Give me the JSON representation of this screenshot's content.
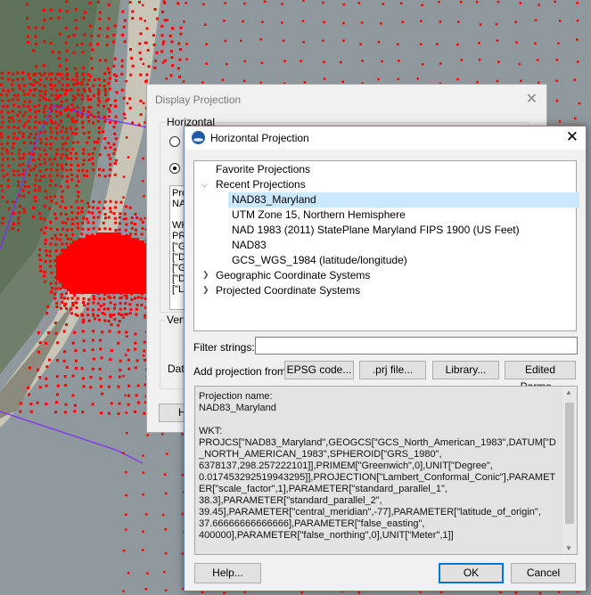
{
  "background_window": {
    "title": "Display Projection",
    "close": "✕",
    "group_horizontal": "Horizontal",
    "group_vertical_partial": "Vert",
    "datum_partial": "Dat",
    "wkt_partial_lines": [
      "Proj",
      "NAD",
      "",
      "WK",
      "PR",
      "[\"G",
      "[\"D",
      "[\"G",
      "[\"D",
      "[\"L"
    ],
    "button_partial": "H"
  },
  "dialog": {
    "title": "Horizontal Projection",
    "close": "✕",
    "tree": {
      "favorite": "Favorite Projections",
      "recent": "Recent Projections",
      "recent_items": [
        "NAD83_Maryland",
        "UTM Zone 15, Northern Hemisphere",
        "NAD 1983 (2011) StatePlane Maryland FIPS 1900 (US Feet)",
        "NAD83",
        "GCS_WGS_1984 (latitude/longitude)"
      ],
      "geographic": "Geographic Coordinate Systems",
      "projected": "Projected Coordinate Systems"
    },
    "filter_label": "Filter strings:",
    "filter_value": "",
    "add_from_label": "Add projection from:",
    "buttons": {
      "epsg": "EPSG code...",
      "prj": ".prj file...",
      "library": "Library...",
      "edited": "Edited Parms...",
      "help": "Help...",
      "ok": "OK",
      "cancel": "Cancel"
    },
    "info_text": "Projection name:\nNAD83_Maryland\n\nWKT:\nPROJCS[\"NAD83_Maryland\",GEOGCS[\"GCS_North_American_1983\",DATUM[\"D_NORTH_AMERICAN_1983\",SPHEROID[\"GRS_1980\",\n6378137,298.257222101]],PRIMEM[\"Greenwich\",0],UNIT[\"Degree\",\n0.017453292519943295]],PROJECTION[\"Lambert_Conformal_Conic\"],PARAMETER[\"scale_factor\",1],PARAMETER[\"standard_parallel_1\",\n38.3],PARAMETER[\"standard_parallel_2\",\n39.45],PARAMETER[\"central_meridian\",-77],PARAMETER[\"latitude_of_origin\",\n37.66666666666666],PARAMETER[\"false_easting\",\n400000],PARAMETER[\"false_northing\",0],UNIT[\"Meter\",1]]"
  },
  "colors": {
    "mesh_points": "#ff0000",
    "boundary_line": "#7b2cff",
    "selection": "#cce8ff",
    "default_button_border": "#0078d7"
  }
}
